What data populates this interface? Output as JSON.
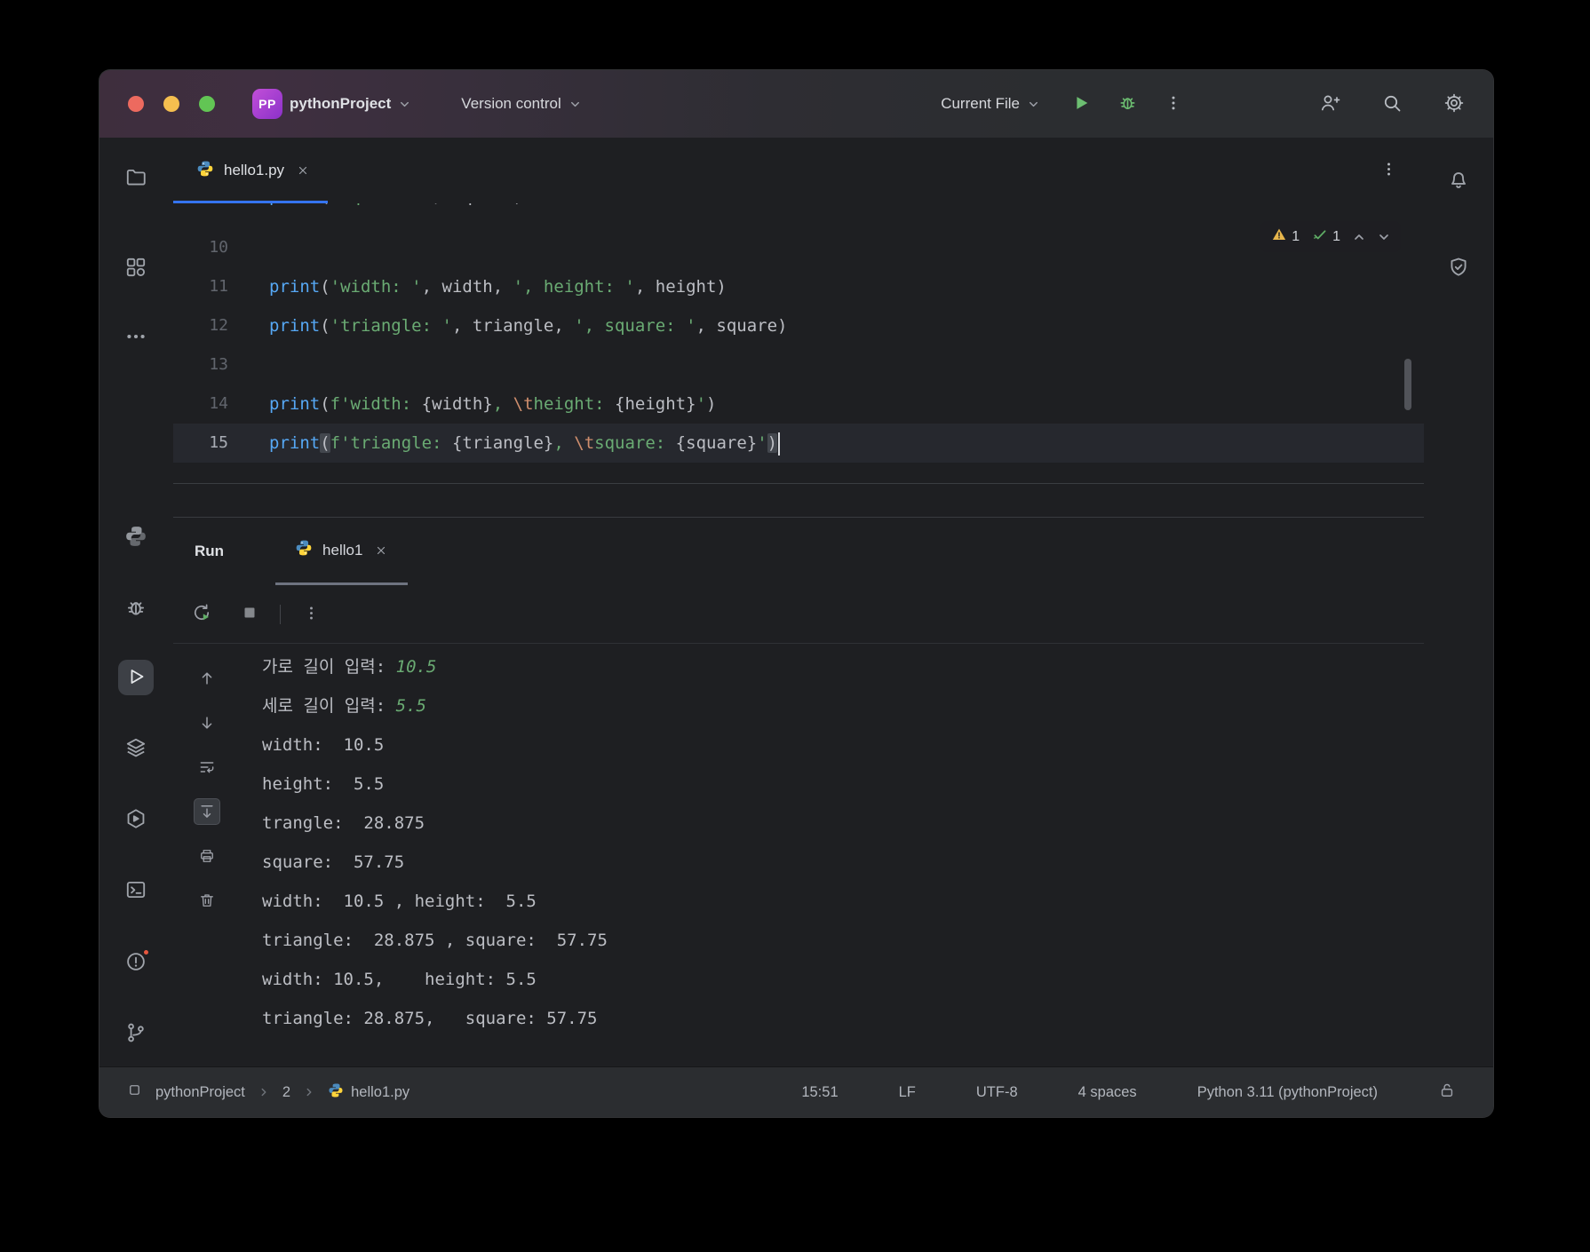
{
  "titlebar": {
    "project_badge": "PP",
    "project_name": "pythonProject",
    "vcs_label": "Version control",
    "run_config": "Current File"
  },
  "editor": {
    "tab_label": "hello1.py",
    "inspection": {
      "warning_count": "1",
      "ok_count": "1"
    },
    "partial_line_tokens": [
      {
        "t": "print",
        "c": "fn"
      },
      {
        "t": "(",
        "c": "pln"
      },
      {
        "t": "'square: '",
        "c": "str"
      },
      {
        "t": ", ",
        "c": "pln"
      },
      {
        "t": "square",
        "c": "pln"
      },
      {
        "t": ")",
        "c": "pln"
      }
    ],
    "lines": [
      {
        "num": "10",
        "tokens": []
      },
      {
        "num": "11",
        "tokens": [
          {
            "t": "print",
            "c": "fn"
          },
          {
            "t": "(",
            "c": "pln"
          },
          {
            "t": "'width: '",
            "c": "str"
          },
          {
            "t": ", ",
            "c": "pln"
          },
          {
            "t": "width",
            "c": "pln"
          },
          {
            "t": ", ",
            "c": "pln"
          },
          {
            "t": "', height: '",
            "c": "str"
          },
          {
            "t": ", ",
            "c": "pln"
          },
          {
            "t": "height",
            "c": "pln"
          },
          {
            "t": ")",
            "c": "pln"
          }
        ]
      },
      {
        "num": "12",
        "tokens": [
          {
            "t": "print",
            "c": "fn"
          },
          {
            "t": "(",
            "c": "pln"
          },
          {
            "t": "'triangle: '",
            "c": "str"
          },
          {
            "t": ", ",
            "c": "pln"
          },
          {
            "t": "triangle",
            "c": "pln"
          },
          {
            "t": ", ",
            "c": "pln"
          },
          {
            "t": "', square: '",
            "c": "str"
          },
          {
            "t": ", ",
            "c": "pln"
          },
          {
            "t": "square",
            "c": "pln"
          },
          {
            "t": ")",
            "c": "pln"
          }
        ]
      },
      {
        "num": "13",
        "tokens": []
      },
      {
        "num": "14",
        "tokens": [
          {
            "t": "print",
            "c": "fn"
          },
          {
            "t": "(",
            "c": "pln"
          },
          {
            "t": "f",
            "c": "str"
          },
          {
            "t": "'width: ",
            "c": "str"
          },
          {
            "t": "{",
            "c": "pln"
          },
          {
            "t": "width",
            "c": "pln"
          },
          {
            "t": "}",
            "c": "pln"
          },
          {
            "t": ", ",
            "c": "str"
          },
          {
            "t": "\\t",
            "c": "esc"
          },
          {
            "t": "height: ",
            "c": "str"
          },
          {
            "t": "{",
            "c": "pln"
          },
          {
            "t": "height",
            "c": "pln"
          },
          {
            "t": "}",
            "c": "pln"
          },
          {
            "t": "'",
            "c": "str"
          },
          {
            "t": ")",
            "c": "pln"
          }
        ]
      },
      {
        "num": "15",
        "current": true,
        "cursor": true,
        "tokens": [
          {
            "t": "print",
            "c": "fn"
          },
          {
            "t": "(",
            "c": "pln",
            "m": true
          },
          {
            "t": "f",
            "c": "str"
          },
          {
            "t": "'triangle: ",
            "c": "str"
          },
          {
            "t": "{",
            "c": "pln"
          },
          {
            "t": "triangle",
            "c": "pln"
          },
          {
            "t": "}",
            "c": "pln"
          },
          {
            "t": ", ",
            "c": "str"
          },
          {
            "t": "\\t",
            "c": "esc"
          },
          {
            "t": "square: ",
            "c": "str"
          },
          {
            "t": "{",
            "c": "pln"
          },
          {
            "t": "square",
            "c": "pln"
          },
          {
            "t": "}",
            "c": "pln"
          },
          {
            "t": "'",
            "c": "str"
          },
          {
            "t": ")",
            "c": "pln",
            "m": true
          }
        ]
      }
    ]
  },
  "run_panel": {
    "title": "Run",
    "tab_label": "hello1",
    "console_lines": [
      [
        {
          "t": "가로 길이 입력: ",
          "c": "out"
        },
        {
          "t": "10.5",
          "c": "input"
        }
      ],
      [
        {
          "t": "세로 길이 입력: ",
          "c": "out"
        },
        {
          "t": "5.5",
          "c": "input"
        }
      ],
      [
        {
          "t": "width:  10.5",
          "c": "out"
        }
      ],
      [
        {
          "t": "height:  5.5",
          "c": "out"
        }
      ],
      [
        {
          "t": "trangle:  28.875",
          "c": "out"
        }
      ],
      [
        {
          "t": "square:  57.75",
          "c": "out"
        }
      ],
      [
        {
          "t": "width:  10.5 , height:  5.5",
          "c": "out"
        }
      ],
      [
        {
          "t": "triangle:  28.875 , square:  57.75",
          "c": "out"
        }
      ],
      [
        {
          "t": "width: 10.5,    height: 5.5",
          "c": "out"
        }
      ],
      [
        {
          "t": "triangle: 28.875,   square: 57.75",
          "c": "out"
        }
      ]
    ]
  },
  "status_bar": {
    "project": "pythonProject",
    "folder": "2",
    "file": "hello1.py",
    "cursor": "15:51",
    "line_sep": "LF",
    "encoding": "UTF-8",
    "indent": "4 spaces",
    "interpreter": "Python 3.11 (pythonProject)"
  },
  "colors": {
    "accent": "#3574f0",
    "string": "#6aab73",
    "function_call": "#56a8f5",
    "escape": "#cf8e6d",
    "warning": "#e8b64c",
    "ok": "#5fad65",
    "console_input": "#6aab73"
  },
  "icons": {
    "left_toolbar": [
      "folder-icon",
      "structure-icon",
      "more-horizontal-icon",
      "python-packages-icon",
      "debug-icon",
      "run-icon",
      "services-layers-icon",
      "services-play-icon",
      "terminal-icon",
      "problems-icon",
      "git-branch-icon"
    ],
    "right_toolbar": [
      "bell-icon",
      "shield-check-icon"
    ]
  }
}
